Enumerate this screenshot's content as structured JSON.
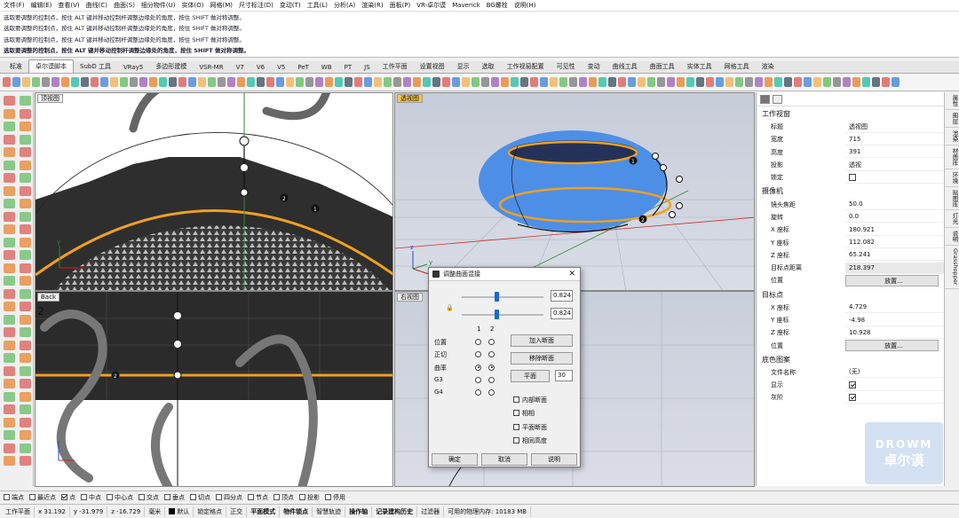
{
  "menu": [
    "文件(F)",
    "编辑(E)",
    "查看(V)",
    "曲线(C)",
    "曲面(S)",
    "细分物件(U)",
    "实体(O)",
    "网格(M)",
    "尺寸标注(D)",
    "变动(T)",
    "工具(L)",
    "分析(A)",
    "渲染(R)",
    "面板(P)",
    "VR-卓尔谟",
    "Maverick",
    "BG螺栓",
    "说明(H)"
  ],
  "command_history": [
    "选取要调整的控制点，按住 ALT 键并移动控制杆调整边缘处的角度，按住 SHIFT 做对称调整。",
    "选取要调整的控制点，按住 ALT 键并移动控制杆调整边缘处的角度，按住 SHIFT 做对称调整。",
    "选取要调整的控制点，按住 ALT 键并移动控制杆调整边缘处的角度，按住 SHIFT 做对称调整。",
    "选取要调整的控制点，按住 ALT 键并移动控制杆调整边缘处的角度，按住 SHIFT 做对称调整。"
  ],
  "command_prompt": "选取要调整的控制点，按住 ALT 键并移动控制杆调整边缘处的角度，按住 SHIFT 做对称调整。",
  "tabs": [
    "标准",
    "卓尔谟脚本",
    "SubD 工具",
    "VRay5",
    "多边形建模",
    "VSR-MR",
    "V7",
    "V6",
    "V5",
    "PeT",
    "WB",
    "PT",
    "JS",
    "工作平面",
    "设置视图",
    "显示",
    "选取",
    "工作视窗配置",
    "可见性",
    "变动",
    "曲线工具",
    "曲面工具",
    "实体工具",
    "网格工具",
    "渲染"
  ],
  "active_tab": "卓尔谟脚本",
  "viewports": {
    "top": {
      "title": "顶视图",
      "x_label": "x",
      "y_label": "y",
      "points": [
        "2",
        "1"
      ]
    },
    "perspective": {
      "title": "透视图",
      "points": [
        "1",
        "2"
      ],
      "z_label": "z",
      "x_label": "x",
      "y_label": "y"
    },
    "back": {
      "title": "Back",
      "points": [
        "2"
      ],
      "marker": "2"
    },
    "right": {
      "title": "右视图"
    }
  },
  "dialog": {
    "title": "调整曲面混接",
    "value1": "0.824",
    "value2": "0.824",
    "lock_icon": "lock-icon",
    "col1": "1",
    "col2": "2",
    "rows": [
      {
        "label": "位置",
        "c1": false,
        "c2": false
      },
      {
        "label": "正切",
        "c1": false,
        "c2": false
      },
      {
        "label": "曲率",
        "c1": true,
        "c2": true
      },
      {
        "label": "G3",
        "c1": false,
        "c2": false
      },
      {
        "label": "G4",
        "c1": false,
        "c2": false
      }
    ],
    "add_section": "加入断面",
    "remove_section": "移除断面",
    "planar": "平面",
    "planar_value": "30",
    "checkboxes": [
      "内部断面",
      "相相",
      "平面断面",
      "相同高度"
    ],
    "ok": "确定",
    "cancel": "取消",
    "help": "说明"
  },
  "properties": {
    "section_viewport": "工作视窗",
    "rows_viewport": [
      {
        "k": "标题",
        "v": "透视图"
      },
      {
        "k": "宽度",
        "v": "715"
      },
      {
        "k": "高度",
        "v": "391"
      },
      {
        "k": "投影",
        "v": "透视"
      },
      {
        "k": "锁定",
        "v": ""
      }
    ],
    "section_camera": "摄像机",
    "rows_camera": [
      {
        "k": "镜头焦距",
        "v": "50.0"
      },
      {
        "k": "旋转",
        "v": "0.0"
      },
      {
        "k": "X 座标",
        "v": "180.921"
      },
      {
        "k": "Y 座标",
        "v": "112.082"
      },
      {
        "k": "Z 座标",
        "v": "65.241"
      },
      {
        "k": "目标点距离",
        "v": "218.397"
      },
      {
        "k": "位置",
        "v": "放置..."
      }
    ],
    "section_target": "目标点",
    "rows_target": [
      {
        "k": "X 座标",
        "v": "4.729"
      },
      {
        "k": "Y 座标",
        "v": "-4.98"
      },
      {
        "k": "Z 座标",
        "v": "10.928"
      },
      {
        "k": "位置",
        "v": "放置..."
      }
    ],
    "section_wallpaper": "底色图案",
    "rows_wallpaper": [
      {
        "k": "文件名称",
        "v": "(无)"
      },
      {
        "k": "显示",
        "v": ""
      },
      {
        "k": "灰阶",
        "v": ""
      }
    ],
    "more_button": "..."
  },
  "right_tabs": [
    "属性",
    "图层",
    "渲染",
    "材质库",
    "环境",
    "贴图库",
    "灯光",
    "说明",
    "Grasshopper"
  ],
  "osnap": [
    {
      "label": "端点",
      "on": false
    },
    {
      "label": "最近点",
      "on": false
    },
    {
      "label": "点",
      "on": true
    },
    {
      "label": "中点",
      "on": false
    },
    {
      "label": "中心点",
      "on": false
    },
    {
      "label": "交点",
      "on": false
    },
    {
      "label": "垂点",
      "on": false
    },
    {
      "label": "切点",
      "on": false
    },
    {
      "label": "四分点",
      "on": false
    },
    {
      "label": "节点",
      "on": false
    },
    {
      "label": "顶点",
      "on": false
    },
    {
      "label": "投影",
      "on": false
    },
    {
      "label": "停用",
      "on": false
    }
  ],
  "status": {
    "cplane": "工作平面",
    "x": "x 31.192",
    "y": "y -31.979",
    "z": "z -16.729",
    "unit": "毫米",
    "layer": "默认",
    "items": [
      "锁定格点",
      "正交",
      "平面模式",
      "物件锁点",
      "智慧轨迹",
      "操作轴",
      "记录建构历史",
      "过滤器"
    ],
    "memory": "可用的物理内存: 10183 MB"
  },
  "watermark": {
    "line1": "DROWM",
    "line2": "卓尔谟"
  },
  "colors": {
    "orange": "#f0a020",
    "blue_surface": "#4d8fe6",
    "active_title": "#f7c64a"
  }
}
